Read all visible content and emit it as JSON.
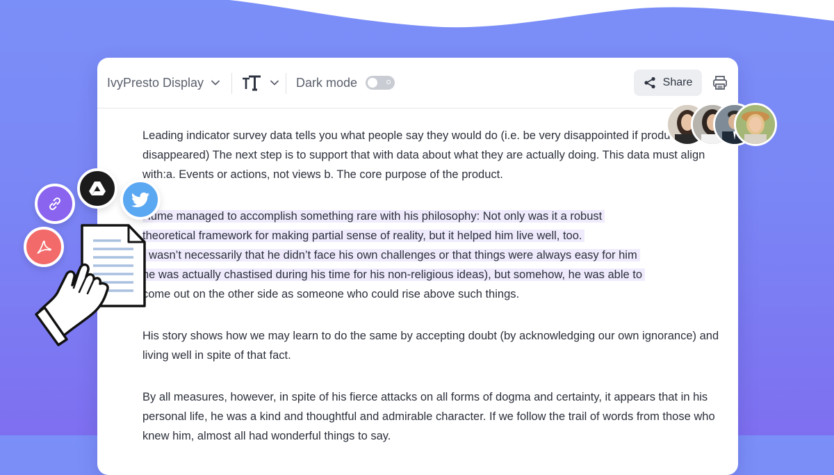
{
  "toolbar": {
    "font_name": "IvyPresto Display",
    "dark_mode_label": "Dark mode",
    "dark_mode_on": false,
    "share_label": "Share"
  },
  "content": {
    "paragraph1": "Leading indicator survey data tells you what people say they would do (i.e. be very disappointed if product disappeared) The next step is to support that with data about what they are actually doing. This data must align with:a. Events or actions, not views b. The core purpose of the product.",
    "paragraph2_lines": [
      "Hume managed to accomplish something rare with his philosophy: Not only was it a robust",
      "theoretical framework for making partial sense of reality, but it helped him live well, too.",
      "t wasn’t necessarily that he didn’t face his own challenges or that things were always easy for him",
      "he was actually chastised during his time for his non-religious ideas), but somehow, he was able to",
      "come out on the other side as someone who could rise above such things."
    ],
    "paragraph3": "His story shows how we may learn to do the same by accepting doubt (by acknowledging our own ignorance) and living well in spite of that fact.",
    "paragraph4": "By all measures, however, in spite of his fierce attacks on all forms of dogma and certainty, it appears that in his personal life, he was a kind and thoughtful and admirable character. If we follow the trail of words from those who knew him, almost all had wonderful things to say."
  },
  "colors": {
    "background_top": "#7b8ff8",
    "background_bottom": "#7e6ff0",
    "highlight": "#efebfd",
    "link_icon": "#8a63ee",
    "drive_icon": "#1b1b1b",
    "twitter_icon": "#5aa7f2",
    "pdf_icon": "#f26a6a"
  },
  "icons": {
    "share": "share-icon",
    "print": "print-icon",
    "link": "link-icon",
    "drive": "drive-icon",
    "twitter": "twitter-icon",
    "pdf": "pdf-icon"
  }
}
